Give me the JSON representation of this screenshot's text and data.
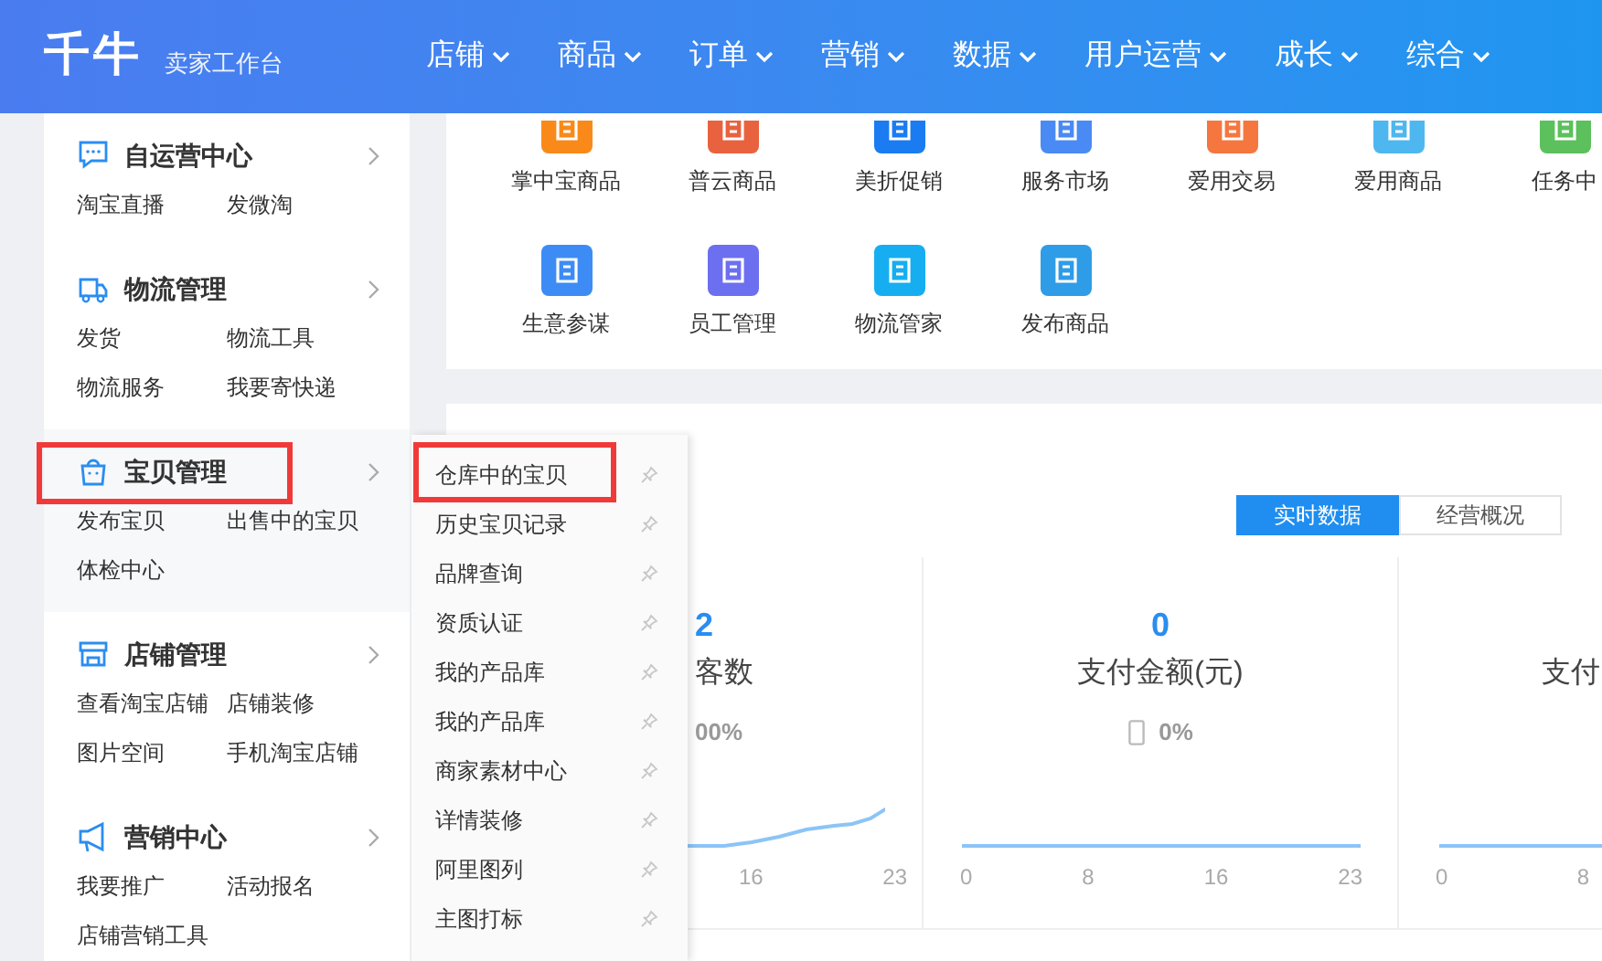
{
  "header": {
    "logo": "千牛",
    "subtitle": "卖家工作台",
    "nav": [
      {
        "label": "店铺"
      },
      {
        "label": "商品"
      },
      {
        "label": "订单"
      },
      {
        "label": "营销"
      },
      {
        "label": "数据"
      },
      {
        "label": "用户运营"
      },
      {
        "label": "成长"
      },
      {
        "label": "综合"
      }
    ]
  },
  "sidebar": {
    "sections": [
      {
        "kind": "chat",
        "title": "自运营中心",
        "annotated": false,
        "links": [
          "淘宝直播",
          "发微淘"
        ]
      },
      {
        "kind": "truck",
        "title": "物流管理",
        "annotated": false,
        "links": [
          "发货",
          "物流工具",
          "物流服务",
          "我要寄快递"
        ]
      },
      {
        "kind": "bag",
        "title": "宝贝管理",
        "annotated": true,
        "links": [
          "发布宝贝",
          "出售中的宝贝",
          "体检中心"
        ]
      },
      {
        "kind": "shop",
        "title": "店铺管理",
        "annotated": false,
        "links": [
          "查看淘宝店铺",
          "店铺装修",
          "图片空间",
          "手机淘宝店铺"
        ]
      },
      {
        "kind": "megaphone",
        "title": "营销中心",
        "annotated": false,
        "links": [
          "我要推广",
          "活动报名",
          "店铺营销工具"
        ]
      }
    ]
  },
  "submenu": {
    "items": [
      {
        "label": "仓库中的宝贝",
        "annotated": true
      },
      {
        "label": "历史宝贝记录",
        "annotated": false
      },
      {
        "label": "品牌查询",
        "annotated": false
      },
      {
        "label": "资质认证",
        "annotated": false
      },
      {
        "label": "我的产品库",
        "annotated": false
      },
      {
        "label": "我的产品库",
        "annotated": false
      },
      {
        "label": "商家素材中心",
        "annotated": false
      },
      {
        "label": "详情装修",
        "annotated": false
      },
      {
        "label": "阿里图列",
        "annotated": false
      },
      {
        "label": "主图打标",
        "annotated": false
      }
    ]
  },
  "apps": [
    [
      {
        "label": "掌中宝商品",
        "color": "#f98a1a"
      },
      {
        "label": "普云商品",
        "color": "#e8623f"
      },
      {
        "label": "美折促销",
        "color": "#1a7cf0"
      },
      {
        "label": "服务市场",
        "color": "#4a8af4"
      },
      {
        "label": "爱用交易",
        "color": "#f5773f"
      },
      {
        "label": "爱用商品",
        "color": "#4fb7ef"
      },
      {
        "label": "任务中",
        "color": "#5cc05c"
      }
    ],
    [
      {
        "label": "生意参谋",
        "color": "#3d8cf5"
      },
      {
        "label": "员工管理",
        "color": "#6c6ff0"
      },
      {
        "label": "物流管家",
        "color": "#16aef0"
      },
      {
        "label": "发布商品",
        "color": "#2f9ce8"
      }
    ]
  ],
  "stats": {
    "tabs": [
      {
        "label": "实时数据",
        "selected": true
      },
      {
        "label": "经营概况",
        "selected": false
      }
    ],
    "panels": [
      {
        "kind": "partial-left",
        "value": "2",
        "label": "客数",
        "change": "00%",
        "x_labels": [
          "16",
          "23"
        ]
      },
      {
        "kind": "full",
        "value": "0",
        "label": "支付金额(元)",
        "change": "0%",
        "x_labels": [
          "0",
          "8",
          "16",
          "23"
        ]
      },
      {
        "kind": "partial-right",
        "label": "支付",
        "x_labels": [
          "0",
          "8"
        ]
      }
    ]
  }
}
